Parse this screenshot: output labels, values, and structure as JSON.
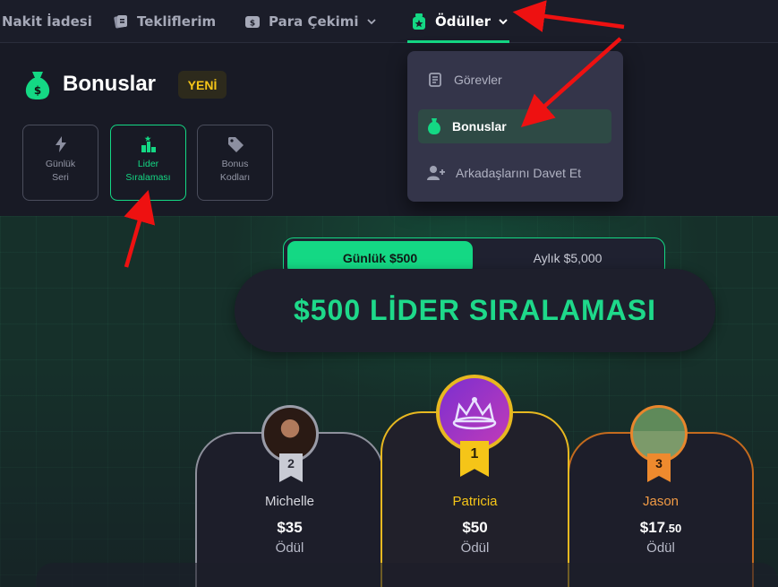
{
  "topnav": {
    "items": [
      {
        "label": "Nakit İadesi"
      },
      {
        "label": "Tekliflerim"
      },
      {
        "label": "Para Çekimi"
      },
      {
        "label": "Ödüller"
      }
    ]
  },
  "dropdown": {
    "items": [
      {
        "label": "Görevler"
      },
      {
        "label": "Bonuslar"
      },
      {
        "label": "Arkadaşlarını Davet Et"
      }
    ]
  },
  "header": {
    "title": "Bonuslar",
    "badge": "YENİ",
    "tiles": [
      {
        "line1": "Günlük",
        "line2": "Seri"
      },
      {
        "line1": "Lider",
        "line2": "Sıralaması"
      },
      {
        "line1": "Bonus",
        "line2": "Kodları"
      }
    ]
  },
  "leaderboard": {
    "toggle": {
      "daily": "Günlük $500",
      "monthly": "Aylık $5,000"
    },
    "banner": "$500 LİDER SIRALAMASI",
    "podium": [
      {
        "rank": "2",
        "name": "Michelle",
        "prize": "$35",
        "prize_label": "Ödül"
      },
      {
        "rank": "1",
        "name": "Patricia",
        "prize": "$50",
        "prize_label": "Ödül"
      },
      {
        "rank": "3",
        "name": "Jason",
        "prize_main": "$17",
        "prize_cents": ".50",
        "prize_label": "Ödül"
      }
    ]
  },
  "colors": {
    "accent": "#14d884",
    "gold": "#f5c518",
    "silver": "#b9bcc8",
    "bronze": "#e8862c",
    "annotation": "#ee1111"
  }
}
